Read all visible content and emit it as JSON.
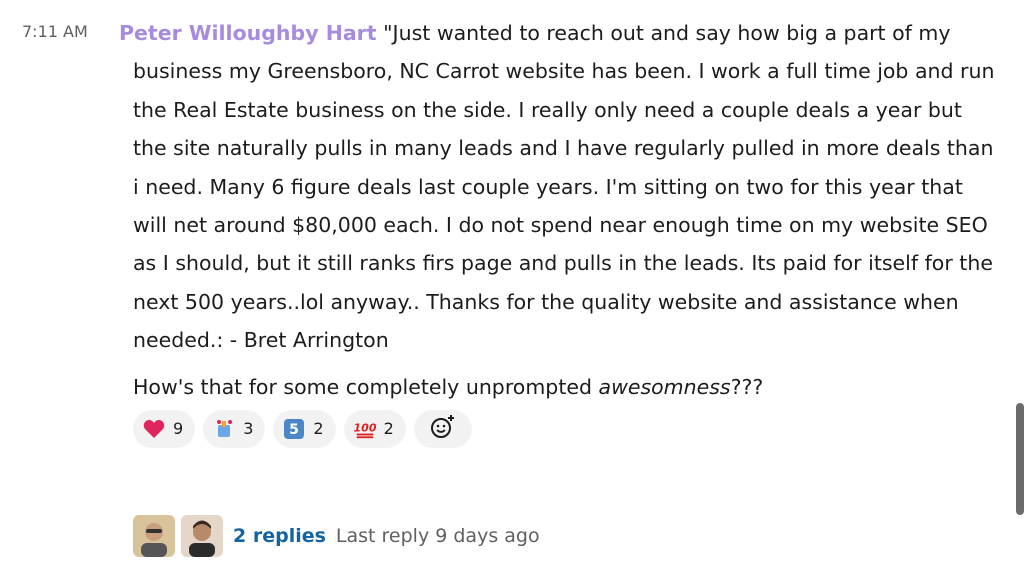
{
  "message": {
    "time": "7:11 AM",
    "sender": "Peter Willoughby Hart",
    "body": "\"Just wanted to reach out and say how big a part of my business my Greensboro, NC Carrot website has been. I work a full time job and run the Real Estate business on the side. I really only need a couple deals a year but the site naturally pulls in many leads and I have regularly pulled in more deals than i need. Many 6 figure deals last couple years. I'm sitting on two for this year that will net around $80,000 each. I do not spend near enough time on my website SEO as I should, but it still ranks firs page and pulls in the leads. Its paid for itself for the next 500 years..lol anyway.. Thanks for the quality website and assistance when needed.: - Bret Arrington",
    "followup_prefix": "How's that for some completely unprompted ",
    "followup_em": "awesomness",
    "followup_suffix": "???"
  },
  "reactions": [
    {
      "icon": "heart-icon",
      "count": "9"
    },
    {
      "icon": "celebrate-icon",
      "count": "3"
    },
    {
      "icon": "keycap-5-icon",
      "count": "2"
    },
    {
      "icon": "hundred-points-icon",
      "count": "2"
    }
  ],
  "thread": {
    "replies_label": "2 replies",
    "last_reply": "Last reply 9 days ago"
  },
  "colors": {
    "sender": "#a78bdc",
    "link": "#1264a3",
    "muted": "#616061",
    "pill_bg": "#f2f2f2"
  }
}
